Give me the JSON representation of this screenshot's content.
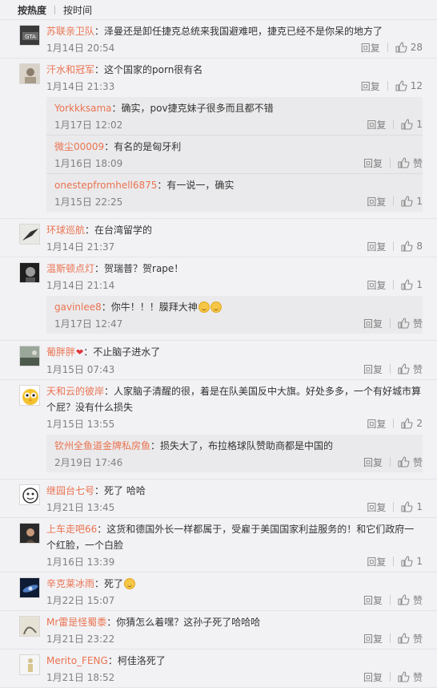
{
  "sort": {
    "hot": "按热度",
    "time": "按时间"
  },
  "labels": {
    "reply": "回复",
    "like_zero": "赞"
  },
  "colors": {
    "username": "#eb7350",
    "meta": "#808080",
    "sub_bg": "#eaeaec"
  },
  "comments": [
    {
      "user": "苏联亲卫队",
      "text": "：泽曼还是卸任捷克总统来我国避难吧，捷克已经不是你呆的地方了",
      "time": "1月14日 20:54",
      "likes": "28",
      "avatar": "gta-cover"
    },
    {
      "user": "汗水和冠军",
      "text": "：这个国家的porn很有名",
      "time": "1月14日 21:33",
      "likes": "12",
      "avatar": "portrait",
      "replies": [
        {
          "user": "Yorkkksama",
          "text": "：确实，pov捷克妹子很多而且都不错",
          "time": "1月17日 12:02",
          "likes": "1"
        },
        {
          "user": "微尘00009",
          "text": "：有名的是匈牙利",
          "time": "1月16日 18:09",
          "likes": "赞"
        },
        {
          "user": "onestepfromhell6875",
          "text": "：有一说一，确实",
          "time": "1月15日 22:25",
          "likes": "1"
        }
      ]
    },
    {
      "user": "环球巡航",
      "text": "：在台湾留学的",
      "time": "1月14日 21:37",
      "likes": "8",
      "avatar": "bird"
    },
    {
      "user": "温斯顿点灯",
      "text": "：贺瑞普？贺rape！",
      "time": "1月14日 21:14",
      "likes": "1",
      "avatar": "dark-portrait",
      "replies": [
        {
          "user": "gavinlee8",
          "text": "：你牛！！！膜拜大神",
          "time": "1月17日 12:47",
          "likes": "赞",
          "emoji": 2
        }
      ]
    },
    {
      "user": "葡胖胖",
      "text": "：不止脑子进水了",
      "time": "1月15日 07:43",
      "likes": "赞",
      "avatar": "landscape",
      "badge": "❤"
    },
    {
      "user": "天和云的彼岸",
      "text": "：人家脑子清醒的很，着是在队美国反中大旗。好处多多，一个有好城市算个屁？没有什么损失",
      "time": "1月15日 13:55",
      "likes": "2",
      "avatar": "owl",
      "replies": [
        {
          "user": "钦州全鱼道金牌私房鱼",
          "text": "：损失大了，布拉格球队赞助商都是中国的",
          "time": "2月19日 17:46",
          "likes": "赞"
        }
      ]
    },
    {
      "user": "继园台七号",
      "text": "：死了 哈哈",
      "time": "1月21日 13:45",
      "likes": "1",
      "avatar": "cartoon"
    },
    {
      "user": "上车走吧66",
      "text": "：这货和德国外长一样都属于，受雇于美国国家利益服务的！和它们政府一个红脸，一个白脸",
      "time": "1月16日 13:39",
      "likes": "1",
      "avatar": "woman"
    },
    {
      "user": "辛克莱冰雨",
      "text": "：死了",
      "time": "1月22日 15:07",
      "likes": "赞",
      "avatar": "galaxy",
      "emoji": 1
    },
    {
      "user": "Mr雷是怪蜀黍",
      "text": "：你猜怎么着嘿？这孙子死了哈哈哈",
      "time": "1月21日 23:22",
      "likes": "赞",
      "avatar": "sketch"
    },
    {
      "user": "Merito_FENG",
      "text": "：柯佳洛死了",
      "time": "1月21日 18:52",
      "likes": "赞",
      "avatar": "figure"
    }
  ]
}
